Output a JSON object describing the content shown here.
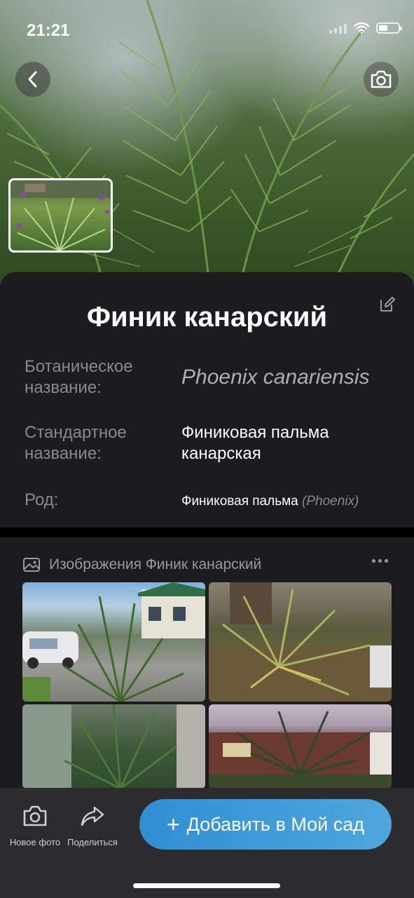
{
  "status_bar": {
    "time": "21:21"
  },
  "hero": {
    "back_icon": "chevron-left-icon",
    "camera_icon": "camera-icon"
  },
  "plant": {
    "title": "Финик канарский",
    "rows": [
      {
        "label": "Ботаническое название:",
        "value": "Phoenix canariensis"
      },
      {
        "label": "Стандартное название:",
        "value": "Финиковая пальма канарская"
      },
      {
        "label": "Род:",
        "value": "Финиковая пальма",
        "value_latin": "(Phoenix)"
      }
    ]
  },
  "images_section": {
    "title": "Изображения Финик канарский"
  },
  "bottom_bar": {
    "new_photo_label": "Новое фото",
    "share_label": "Поделиться",
    "add_label": "Добавить в Мой сад",
    "add_plus": "+"
  },
  "colors": {
    "panel_bg": "#1c1c1e",
    "bar_bg": "#2c2c2e",
    "accent": "#3b96d8",
    "secondary_text": "#8a8a8e"
  }
}
